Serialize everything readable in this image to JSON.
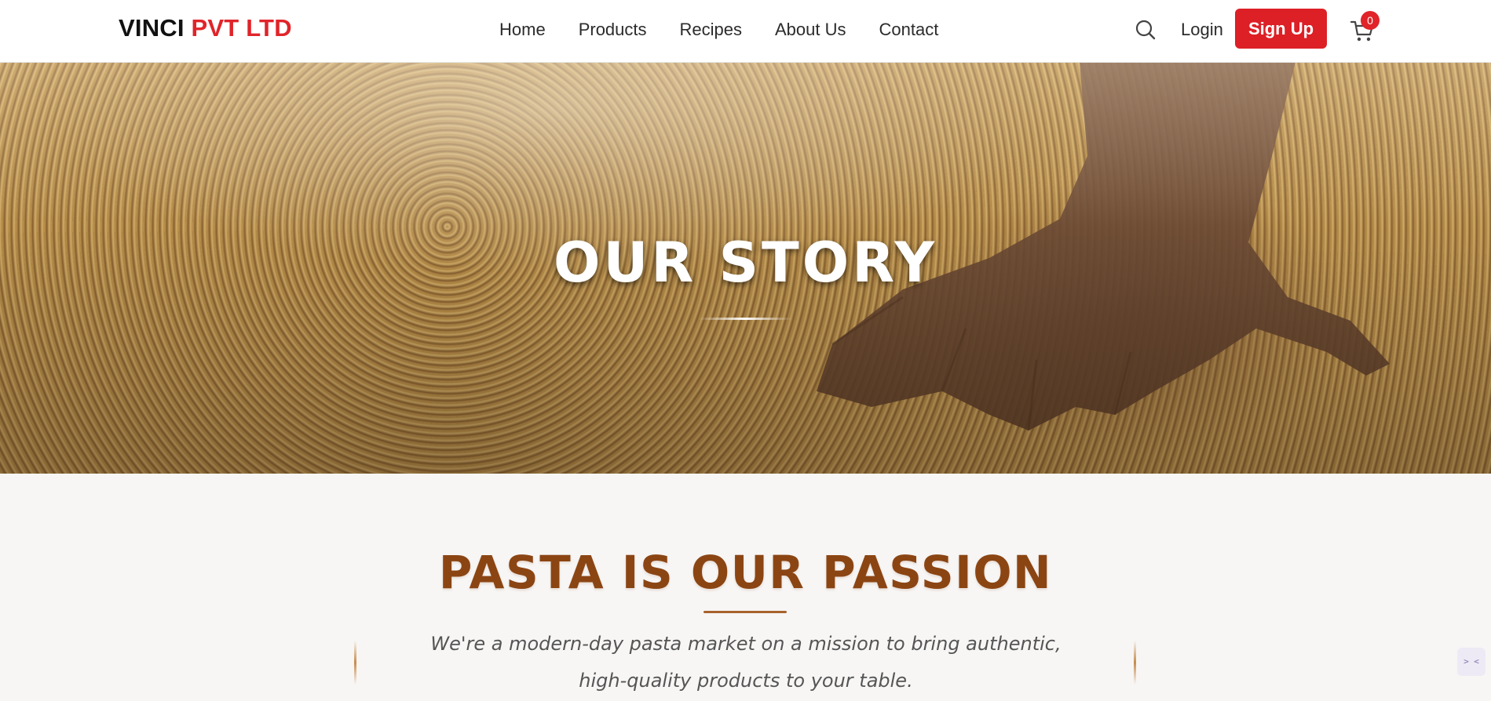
{
  "brand": {
    "name": "VINCI",
    "accent": "PVT LTD"
  },
  "nav": {
    "links": [
      "Home",
      "Products",
      "Recipes",
      "About Us",
      "Contact"
    ],
    "login": "Login",
    "signup": "Sign Up",
    "cart_count": "0",
    "icons": {
      "search": "search-icon",
      "cart": "cart-icon"
    }
  },
  "hero": {
    "title": "OUR STORY"
  },
  "story": {
    "title": "PASTA IS OUR PASSION",
    "text": "We're a modern-day pasta market on a mission to bring authentic, high-quality products to your table."
  },
  "widget": {
    "label": "> <"
  },
  "colors": {
    "brand_red": "#dc2026",
    "section_brown": "#8b4513",
    "nav_text": "#2b2b2b"
  }
}
